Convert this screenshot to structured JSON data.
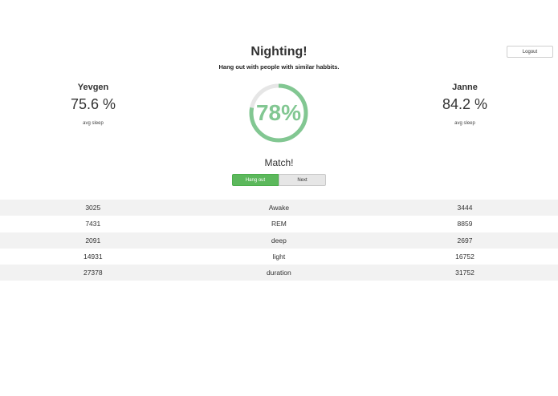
{
  "header": {
    "title": "Nighting!",
    "subtitle": "Hang out with people with similar habbits.",
    "logout_label": "Logout"
  },
  "left_user": {
    "name": "Yevgen",
    "value": "75.6 %",
    "caption": "avg sleep"
  },
  "right_user": {
    "name": "Janne",
    "value": "84.2 %",
    "caption": "avg sleep"
  },
  "match_gauge": {
    "label": "78%",
    "fraction": 0.78,
    "color": "#82c792",
    "track_color": "#e6e6e6"
  },
  "match": {
    "label": "Match!",
    "hang_out_label": "Hang out",
    "next_label": "Next"
  },
  "stats": {
    "rows": [
      {
        "left": "3025",
        "label": "Awake",
        "right": "3444"
      },
      {
        "left": "7431",
        "label": "REM",
        "right": "8859"
      },
      {
        "left": "2091",
        "label": "deep",
        "right": "2697"
      },
      {
        "left": "14931",
        "label": "light",
        "right": "16752"
      },
      {
        "left": "27378",
        "label": "duration",
        "right": "31752"
      }
    ]
  }
}
